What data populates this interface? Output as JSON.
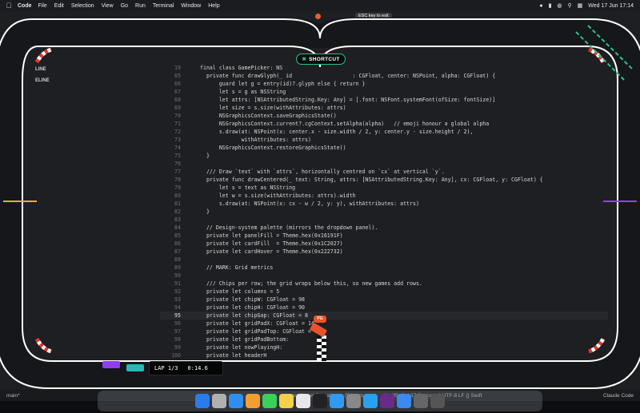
{
  "menubar": {
    "app": "Code",
    "items": [
      "File",
      "Edit",
      "Selection",
      "View",
      "Go",
      "Run",
      "Terminal",
      "Window",
      "Help"
    ],
    "datetime": "Wed 17 Jun  17:14"
  },
  "window": {
    "esc_hint": "ESC key to exit",
    "tab_title": "Ga"
  },
  "left_labels": [
    "LINE",
    "ELINE"
  ],
  "code_lines": [
    {
      "n": "19",
      "t": "final class GamePicker: NS"
    },
    {
      "n": "65",
      "t": "  private func drawGlyph(_ id                   : CGFloat, center: NSPoint, alpha: CGFloat) {"
    },
    {
      "n": "66",
      "t": "      guard let g = entry(id)?.glyph else { return }"
    },
    {
      "n": "67",
      "t": "      let s = g as NSString"
    },
    {
      "n": "68",
      "t": "      let attrs: [NSAttributedString.Key: Any] = [.font: NSFont.systemFont(ofSize: fontSize)]"
    },
    {
      "n": "69",
      "t": "      let size = s.size(withAttributes: attrs)"
    },
    {
      "n": "70",
      "t": "      NSGraphicsContext.saveGraphicsState()"
    },
    {
      "n": "71",
      "t": "      NSGraphicsContext.current?.cgContext.setAlpha(alpha)   // emoji honour a global alpha"
    },
    {
      "n": "72",
      "t": "      s.draw(at: NSPoint(x: center.x - size.width / 2, y: center.y - size.height / 2),"
    },
    {
      "n": "73",
      "t": "             withAttributes: attrs)"
    },
    {
      "n": "74",
      "t": "      NSGraphicsContext.restoreGraphicsState()"
    },
    {
      "n": "75",
      "t": "  }"
    },
    {
      "n": "76",
      "t": ""
    },
    {
      "n": "77",
      "t": "  /// Draw `text` with `attrs`, horizontally centred on `cx` at vertical `y`."
    },
    {
      "n": "78",
      "t": "  private func drawCentered(_ text: String, attrs: [NSAttributedString.Key: Any], cx: CGFloat, y: CGFloat) {"
    },
    {
      "n": "79",
      "t": "      let s = text as NSString"
    },
    {
      "n": "80",
      "t": "      let w = s.size(withAttributes: attrs).width"
    },
    {
      "n": "81",
      "t": "      s.draw(at: NSPoint(x: cx - w / 2, y: y), withAttributes: attrs)"
    },
    {
      "n": "82",
      "t": "  }"
    },
    {
      "n": "83",
      "t": ""
    },
    {
      "n": "84",
      "t": "  // Design-system palette (mirrors the dropdown panel)."
    },
    {
      "n": "85",
      "t": "  private let panelFill = Theme.hex(0x16191F)"
    },
    {
      "n": "86",
      "t": "  private let cardFill  = Theme.hex(0x1C2027)"
    },
    {
      "n": "87",
      "t": "  private let cardHover = Theme.hex(0x222732)"
    },
    {
      "n": "88",
      "t": ""
    },
    {
      "n": "89",
      "t": "  // MARK: Grid metrics"
    },
    {
      "n": "90",
      "t": ""
    },
    {
      "n": "91",
      "t": "  /// Chips per row; the grid wraps below this, so new games add rows."
    },
    {
      "n": "92",
      "t": "  private let columns = 5"
    },
    {
      "n": "93",
      "t": "  private let chipW: CGFloat = 98"
    },
    {
      "n": "94",
      "t": "  private let chipH: CGFloat = 90"
    },
    {
      "n": "95",
      "t": "  private let chipGap: CGFloat = 8"
    },
    {
      "n": "96",
      "t": "  private let gridPadX: CGFloat = 14"
    },
    {
      "n": "97",
      "t": "  private let gridPadTop: CGFloat ="
    },
    {
      "n": "98",
      "t": "  private let gridPadBottom:"
    },
    {
      "n": "99",
      "t": "  private let nowPlayingH:"
    },
    {
      "n": "100",
      "t": "  private let headerH"
    }
  ],
  "current_line": "95",
  "statusbar": {
    "branch": "main*",
    "user": "pratikgcet@gmail.com (5 hours ago)",
    "position": "Ln 95, Col 37   Spaces: 4   UTF-8   LF   {} Swift",
    "right": "Claude Code"
  },
  "game": {
    "shortcut_label": "SHORTCUT",
    "lap_text": "LAP 1/3",
    "time_text": "0:14.6",
    "kart_label": "PG"
  },
  "colors": {
    "track_edge": "#ffffff",
    "accent_green": "#2fc28a",
    "curb_red": "#e8332a",
    "kart_orange": "#e8522a"
  },
  "dock": [
    "finder-icon",
    "launchpad-icon",
    "safari-icon",
    "photos-icon",
    "messages-icon",
    "notes-icon",
    "chrome-icon",
    "terminal-icon",
    "appstore-icon",
    "settings-icon",
    "vscode-icon",
    "slack-icon",
    "mail-icon",
    "system-icon",
    "trash-icon"
  ]
}
